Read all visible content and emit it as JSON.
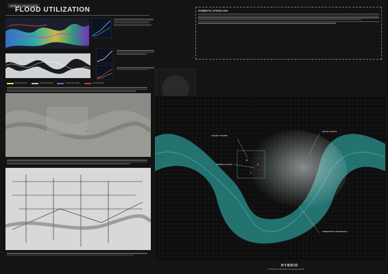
{
  "header": {
    "section_tag": "URBAN ANALYSIS",
    "title": "FLOOD UTILIZATION"
  },
  "legend": {
    "items": [
      {
        "label": "Flood Defences",
        "color": "#f2e24a"
      },
      {
        "label": "Tidal Flood Plain",
        "color": "#a9c9d6"
      },
      {
        "label": "Fluvial Flood Plain",
        "color": "#6a6ab8"
      },
      {
        "label": "Thames Barrier",
        "color": "#d8323a"
      }
    ]
  },
  "proposal": {
    "heading": "SYMBIOTIC UTOPIA 2100",
    "colors": {
      "river": "#2a8c8a",
      "river_glow": "#48c0c2",
      "accent": "#d84040"
    }
  },
  "map_labels": {
    "canary": "CANARY WHARF",
    "docks": "SURREY DOCKS",
    "royal": "ROYAL DOCKS",
    "greenwich": "GREENWICH PENINSULA"
  },
  "footer": {
    "brand": "HYBRID",
    "subtitle": "HYBRIDISED URBANISM AND DEVELOPMENT"
  }
}
